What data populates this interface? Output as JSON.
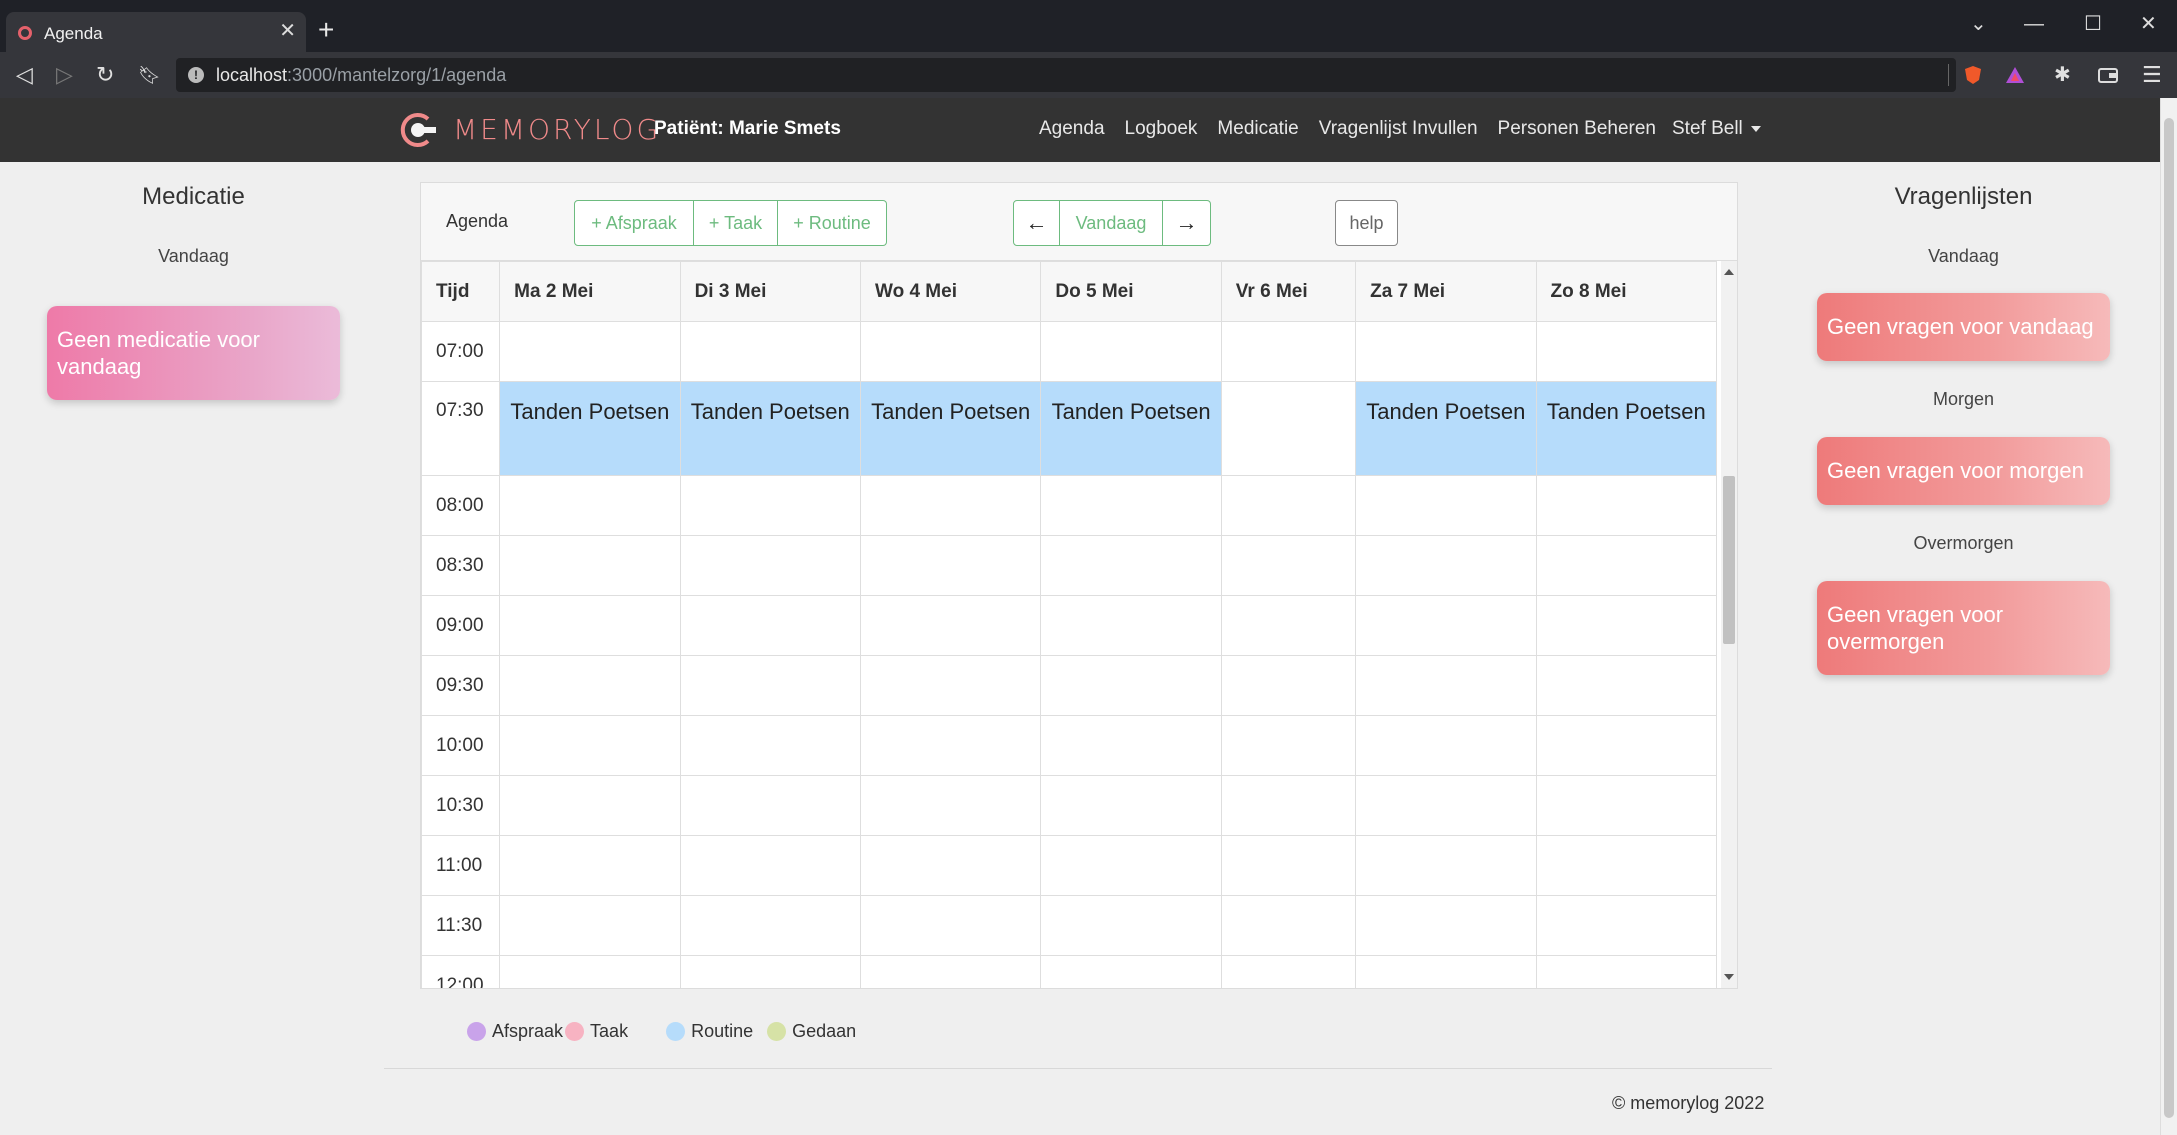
{
  "browser": {
    "tab_title": "Agenda",
    "tab_close": "✕",
    "new_tab": "+",
    "url_host": "localhost",
    "url_rest": ":3000/mantelzorg/1/agenda"
  },
  "nav": {
    "logo_text": "MEMORYLOG",
    "patient": "Patiënt: Marie Smets",
    "links": [
      "Agenda",
      "Logboek",
      "Medicatie",
      "Vragenlijst Invullen",
      "Personen Beheren"
    ],
    "user": "Stef Bell"
  },
  "medicatie": {
    "title": "Medicatie",
    "subtitle": "Vandaag",
    "card": "Geen medicatie voor vandaag"
  },
  "vragenlijsten": {
    "title": "Vragenlijsten",
    "sections": [
      {
        "label": "Vandaag",
        "card": "Geen vragen voor vandaag"
      },
      {
        "label": "Morgen",
        "card": "Geen vragen voor morgen"
      },
      {
        "label": "Overmorgen",
        "card": "Geen vragen voor overmorgen"
      }
    ]
  },
  "calendar": {
    "label": "Agenda",
    "add_buttons": [
      "+ Afspraak",
      "+ Taak",
      "+ Routine"
    ],
    "prev": "←",
    "today": "Vandaag",
    "next": "→",
    "help": "help",
    "time_header": "Tijd",
    "days": [
      "Ma 2 Mei",
      "Di 3 Mei",
      "Wo 4 Mei",
      "Do 5 Mei",
      "Vr 6 Mei",
      "Za 7 Mei",
      "Zo 8 Mei"
    ],
    "times": [
      "07:00",
      "07:30",
      "08:00",
      "08:30",
      "09:00",
      "09:30",
      "10:00",
      "10:30",
      "11:00",
      "11:30",
      "12:00"
    ],
    "routine_label": "Tanden Poetsen"
  },
  "legend": [
    {
      "label": "Afspraak",
      "color": "#c9a3ea"
    },
    {
      "label": "Taak",
      "color": "#f7b3c2"
    },
    {
      "label": "Routine",
      "color": "#b6dcfb"
    },
    {
      "label": "Gedaan",
      "color": "#d6e2a6"
    }
  ],
  "footer": "© memorylog 2022"
}
